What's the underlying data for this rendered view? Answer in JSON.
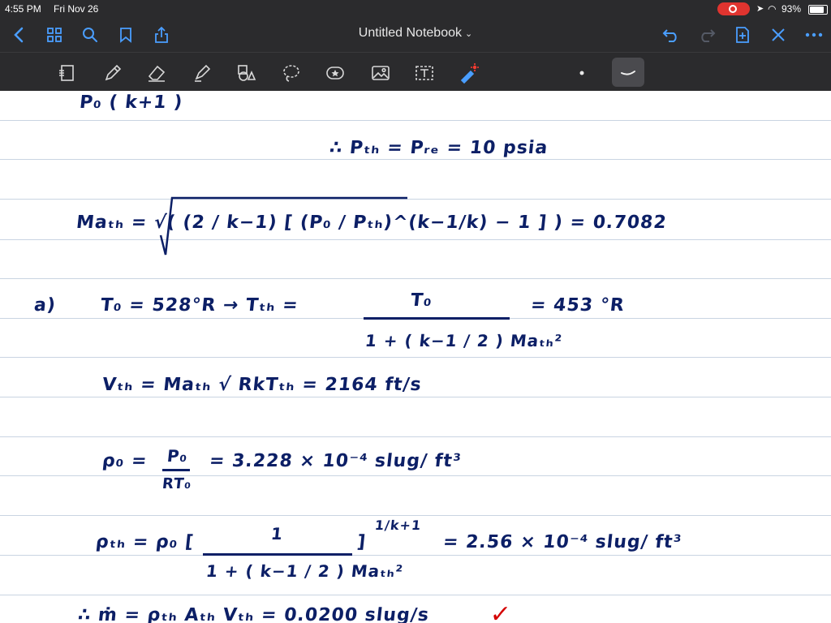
{
  "status_bar": {
    "time": "4:55 PM",
    "date": "Fri Nov 26",
    "battery": "93%",
    "battery_level": 0.93
  },
  "nav": {
    "title": "Untitled Notebook",
    "title_chevron": "⌄"
  },
  "notes": {
    "line1": "P₀        ( k+1 )",
    "line2": "∴   Pₜₕ  =  Pᵣₑ  =  10  psia",
    "line3": "Maₜₕ =  √( (2 / k−1) [ (P₀ / Pₜₕ)^(k−1/k)  − 1 ] )   =  0.7082",
    "label_a": "a)",
    "line4a": "T₀ = 528°R  →     Tₜₕ =",
    "line4_num": "T₀",
    "line4_den": "1 + ( k−1 / 2 ) Maₜₕ²",
    "line4b": "=  453 °R",
    "line5": "Vₜₕ =  Maₜₕ √ RkTₜₕ  =  2164  ft/s",
    "line6a": "ρ₀  =",
    "line6_num": "P₀",
    "line6_den": "RT₀",
    "line6b": "=  3.228 × 10⁻⁴  slug/ ft³",
    "line7a": "ρₜₕ =  ρ₀ [",
    "line7_num": "1",
    "line7_den": "1 + ( k−1 / 2 ) Maₜₕ²",
    "line7_exp": "1/k+1",
    "line7b": "] ",
    "line7c": "=   2.56 × 10⁻⁴  slug/ ft³",
    "line8": "∴ ṁ =  ρₜₕ Aₜₕ Vₜₕ  =  0.0200  slug/s",
    "checkmark": "✓"
  },
  "colors": {
    "ink": "#0c1f66",
    "accent": "#4a9eff",
    "check": "#d40000",
    "chrome": "#2b2b2d"
  }
}
